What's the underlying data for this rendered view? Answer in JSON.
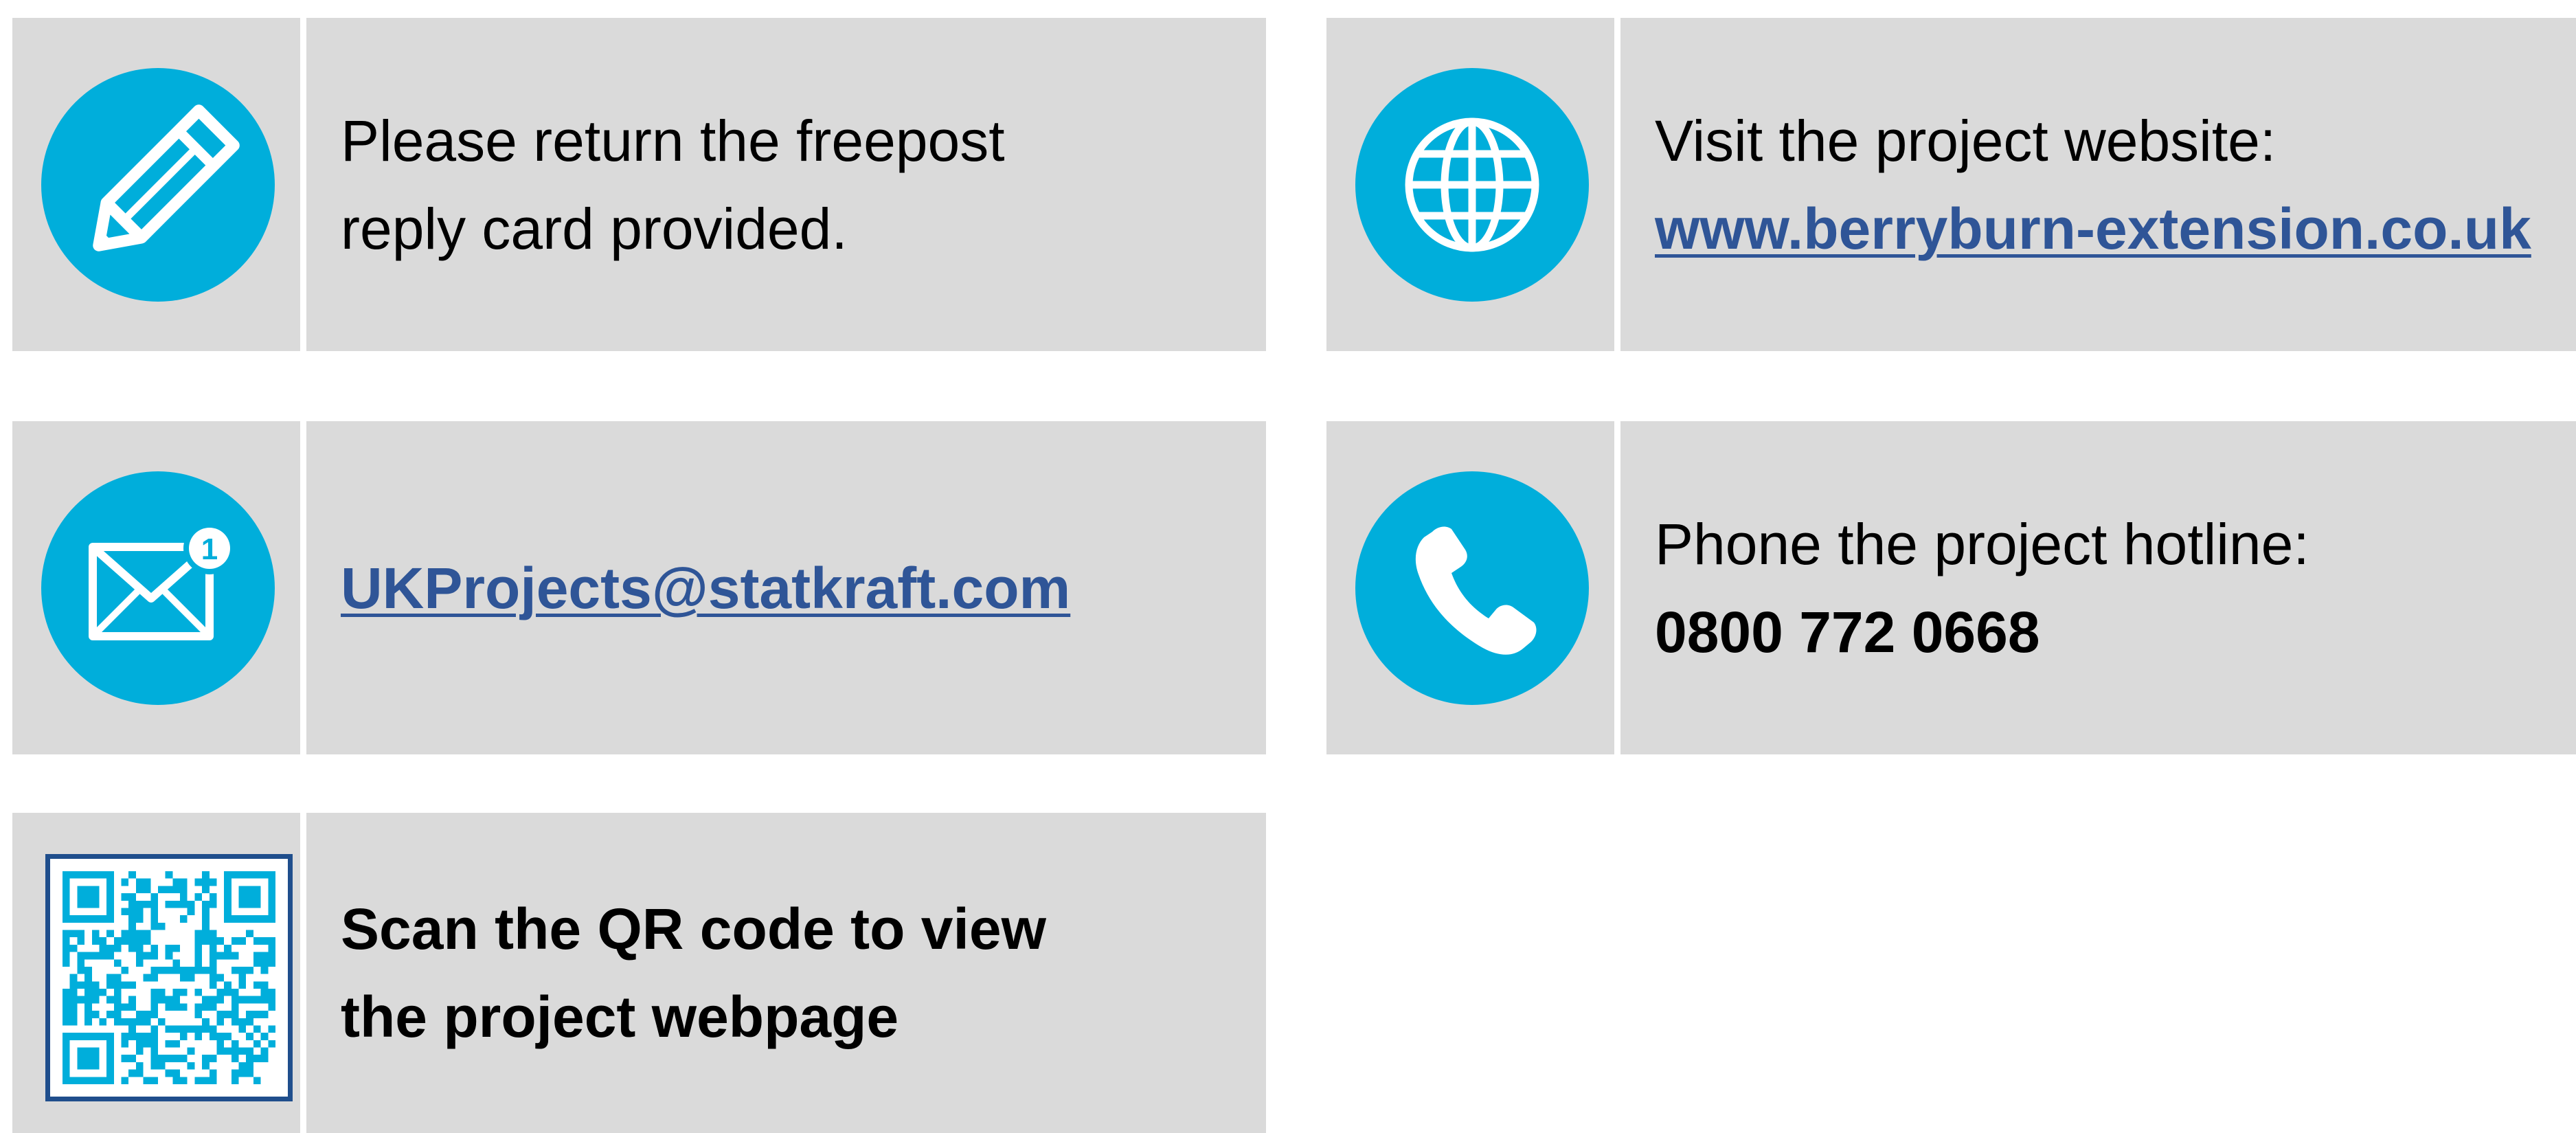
{
  "colors": {
    "panel_bg": "#dadada",
    "icon_circle": "#00aedb",
    "link": "#2f5597",
    "qr_frame": "#1f4e8c",
    "text": "#000000"
  },
  "cards": {
    "reply_card": {
      "icon": "pencil-icon",
      "line1": "Please return the freepost",
      "line2": "reply card provided."
    },
    "website": {
      "icon": "globe-icon",
      "line1": "Visit the project website:",
      "link": "www.berryburn-extension.co.uk"
    },
    "email": {
      "icon": "envelope-notification-icon",
      "badge": "1",
      "link": "UKProjects@statkraft.com"
    },
    "phone": {
      "icon": "phone-icon",
      "line1": "Phone the project hotline:",
      "number": "0800 772 0668"
    },
    "qr": {
      "icon": "qr-code-icon",
      "line1": "Scan the QR code to view",
      "line2": "the project webpage"
    }
  }
}
